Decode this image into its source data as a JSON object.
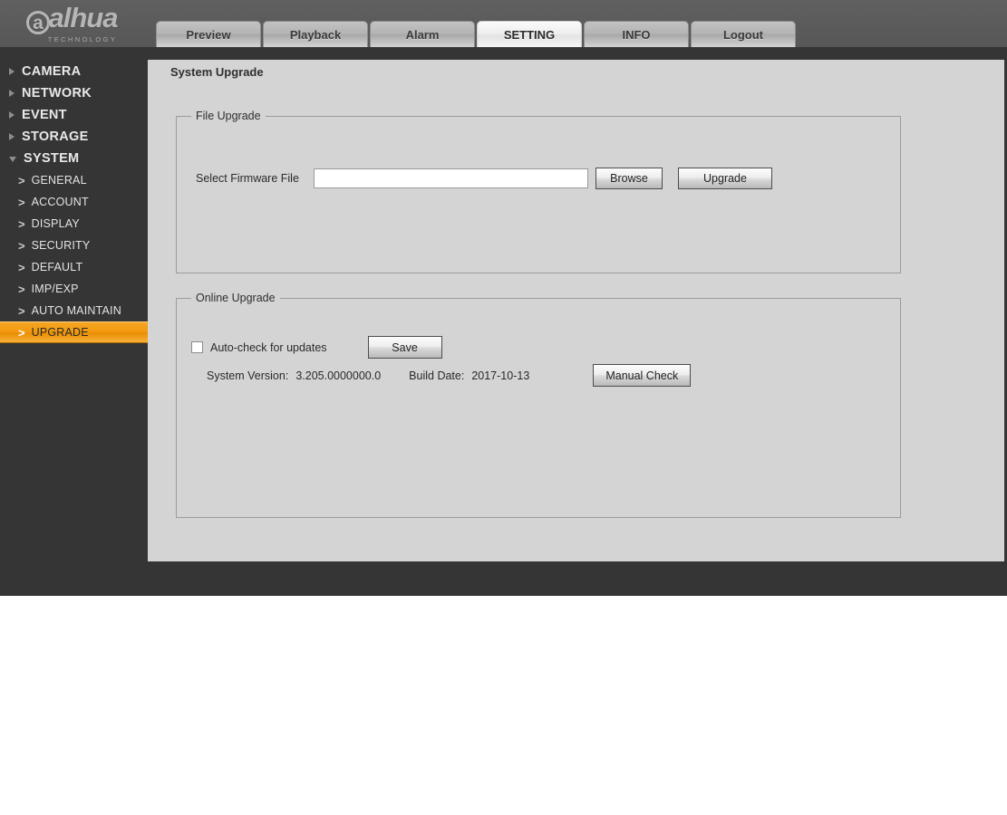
{
  "brand": {
    "name": "alhua",
    "tagline": "TECHNOLOGY"
  },
  "nav_tabs": [
    {
      "label": "Preview",
      "active": false
    },
    {
      "label": "Playback",
      "active": false
    },
    {
      "label": "Alarm",
      "active": false
    },
    {
      "label": "SETTING",
      "active": true
    },
    {
      "label": "INFO",
      "active": false
    },
    {
      "label": "Logout",
      "active": false
    }
  ],
  "sidebar": {
    "groups": [
      {
        "label": "CAMERA",
        "expanded": false,
        "items": []
      },
      {
        "label": "NETWORK",
        "expanded": false,
        "items": []
      },
      {
        "label": "EVENT",
        "expanded": false,
        "items": []
      },
      {
        "label": "STORAGE",
        "expanded": false,
        "items": []
      },
      {
        "label": "SYSTEM",
        "expanded": true,
        "items": [
          {
            "label": "GENERAL",
            "selected": false
          },
          {
            "label": "ACCOUNT",
            "selected": false
          },
          {
            "label": "DISPLAY",
            "selected": false
          },
          {
            "label": "SECURITY",
            "selected": false
          },
          {
            "label": "DEFAULT",
            "selected": false
          },
          {
            "label": "IMP/EXP",
            "selected": false
          },
          {
            "label": "AUTO MAINTAIN",
            "selected": false
          },
          {
            "label": "UPGRADE",
            "selected": true
          }
        ]
      }
    ],
    "chevron_glyph": ">"
  },
  "page_tab": {
    "label": "System Upgrade"
  },
  "file_upgrade": {
    "legend": "File Upgrade",
    "select_label": "Select Firmware File",
    "file_value": "",
    "file_placeholder": "",
    "browse_label": "Browse",
    "upgrade_label": "Upgrade"
  },
  "online_upgrade": {
    "legend": "Online Upgrade",
    "autocheck_label": "Auto-check for updates",
    "autocheck_checked": false,
    "save_label": "Save",
    "system_version_label": "System Version:",
    "system_version_value": "3.205.0000000.0",
    "build_date_label": "Build Date:",
    "build_date_value": "2017-10-13",
    "manual_check_label": "Manual Check"
  },
  "colors": {
    "accent": "#f2a01a",
    "header_bg": "#5b5b5b",
    "dark_bg": "#353535",
    "panel_bg": "#d4d4d4"
  }
}
